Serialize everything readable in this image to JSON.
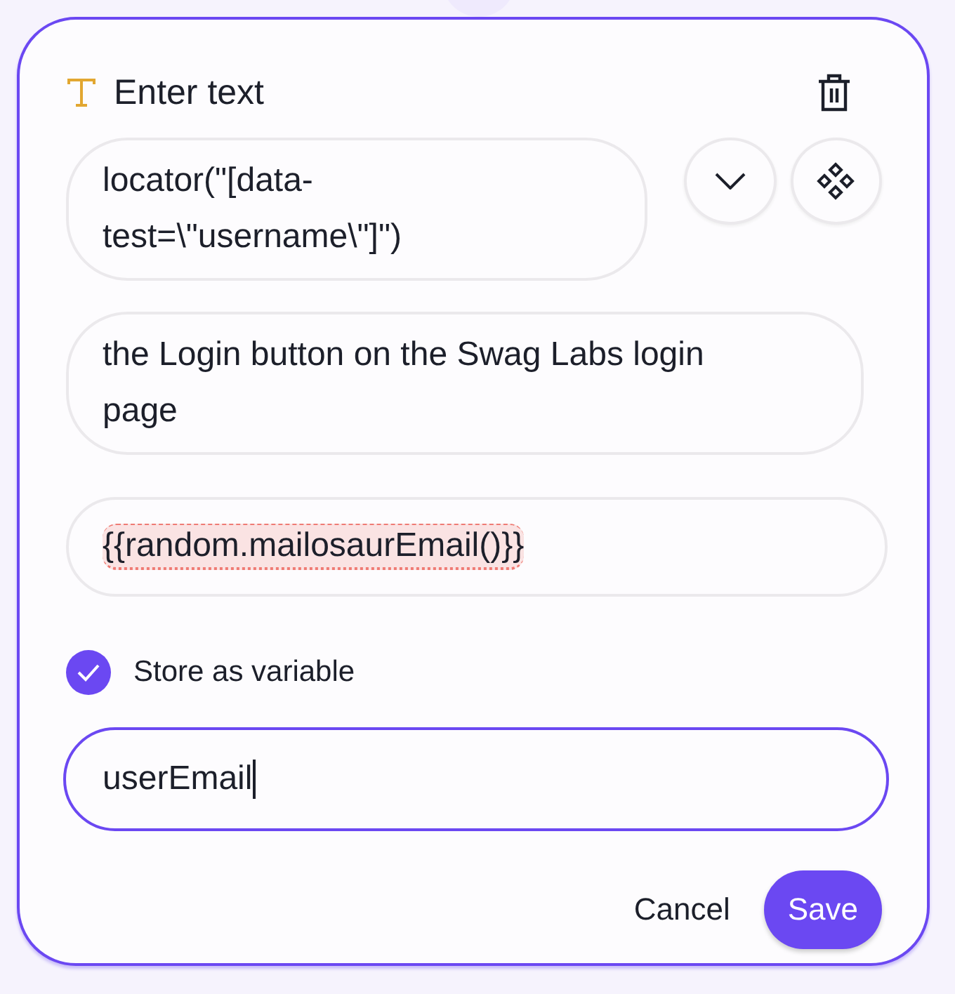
{
  "step": {
    "title": "Enter text"
  },
  "locator": {
    "value": "locator(\"[data-test=\\\"username\\\"]\")"
  },
  "description": {
    "value": "the Login button on the Swag Labs login page"
  },
  "input_value": {
    "value": "{{random.mailosaurEmail()}}",
    "invalid": true
  },
  "store_variable": {
    "label": "Store as variable",
    "checked": true
  },
  "variable_name": {
    "value": "userEmail",
    "focused": true
  },
  "buttons": [
    {
      "label": "Cancel",
      "kind": "secondary"
    },
    {
      "label": "Save",
      "kind": "primary"
    }
  ]
}
